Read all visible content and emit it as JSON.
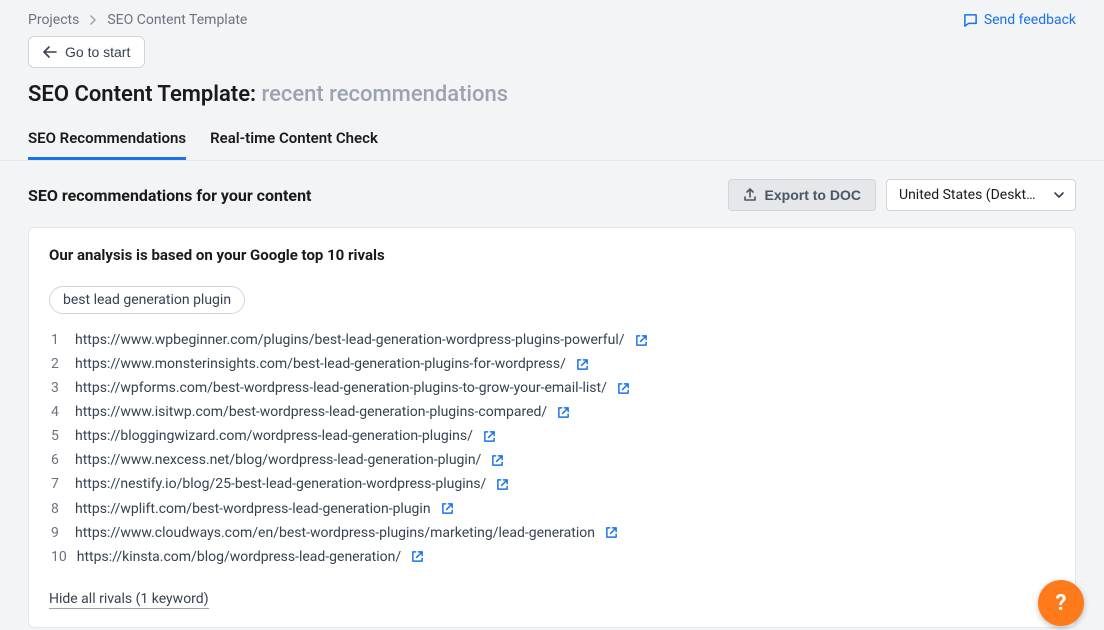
{
  "breadcrumb": {
    "root": "Projects",
    "current": "SEO Content Template"
  },
  "feedback": {
    "label": "Send feedback"
  },
  "go_start": {
    "label": "Go to start"
  },
  "page_title": {
    "main": "SEO Content Template:",
    "sub": "recent recommendations"
  },
  "tabs": [
    {
      "label": "SEO Recommendations",
      "active": true
    },
    {
      "label": "Real-time Content Check",
      "active": false
    }
  ],
  "content": {
    "heading": "SEO recommendations for your content",
    "export_label": "Export to DOC",
    "region_label": "United States (Deskt…"
  },
  "card": {
    "title": "Our analysis is based on your Google top 10 rivals",
    "keyword": "best lead generation plugin",
    "rivals": [
      "https://www.wpbeginner.com/plugins/best-lead-generation-wordpress-plugins-powerful/",
      "https://www.monsterinsights.com/best-lead-generation-plugins-for-wordpress/",
      "https://wpforms.com/best-wordpress-lead-generation-plugins-to-grow-your-email-list/",
      "https://www.isitwp.com/best-wordpress-lead-generation-plugins-compared/",
      "https://bloggingwizard.com/wordpress-lead-generation-plugins/",
      "https://www.nexcess.net/blog/wordpress-lead-generation-plugin/",
      "https://nestify.io/blog/25-best-lead-generation-wordpress-plugins/",
      "https://wplift.com/best-wordpress-lead-generation-plugin",
      "https://www.cloudways.com/en/best-wordpress-plugins/marketing/lead-generation",
      "https://kinsta.com/blog/wordpress-lead-generation/"
    ],
    "hide_label": "Hide all rivals (1 keyword)"
  },
  "fab": {
    "label": "?"
  }
}
